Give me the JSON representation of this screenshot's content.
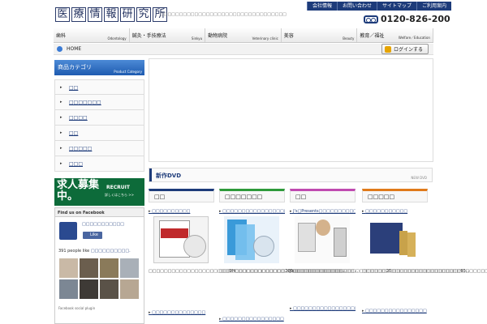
{
  "header": {
    "logo_chars": [
      "医",
      "療",
      "情",
      "報",
      "研",
      "究",
      "所"
    ],
    "tagline": "□□□□□□□□□□□□□□□□□□□□□□□□□□□□□□□□□",
    "util_links": [
      "会社情報",
      "お問い合わせ",
      "サイトマップ",
      "ご利用案内"
    ],
    "phone": "0120-826-200"
  },
  "gnav": [
    {
      "jp": "歯科",
      "en": "Odontology"
    },
    {
      "jp": "鍼灸・手技療法",
      "en": "Sinkyu"
    },
    {
      "jp": "動物病院",
      "en": "Veterinary clinic"
    },
    {
      "jp": "美容",
      "en": "Beauty"
    },
    {
      "jp": "教育／福祉",
      "en": "Welfare／Education"
    }
  ],
  "breadcrumb": "HOME",
  "login_label": "ログインする",
  "sidebar": {
    "title_jp": "商品カテゴリ",
    "title_en": "Product Category",
    "items": [
      "□□",
      "□□□□□□□",
      "□□□□",
      "□□",
      "□□□□□",
      "□□□"
    ]
  },
  "recruit": {
    "big": "求人募集中。",
    "en": "RECRUIT",
    "sub": "詳しくはこちら >>"
  },
  "facebook": {
    "title": "Find us on Facebook",
    "page_name": "□□□□□□□□□□□",
    "like": "Like",
    "count_text": "391 people like",
    "count_page": "□□□□□□□□□□.",
    "footer": "Facebook social plugin"
  },
  "dvd": {
    "title": "新作DVD",
    "en": "NEW DVD"
  },
  "columns": [
    {
      "tab": "□□",
      "link1": "□□□□□□□□□□",
      "desc1": "□□□□□□□□□□□□□□□□□□□□□DH□□□□□□□□□□□□□200□□□□□□□□□□□□□□□□...",
      "link2": "□□□□□□□□□□□□□□"
    },
    {
      "tab": "□□□□□□□",
      "link1": "□□□□□□□□□□□□□□□□□□□□□",
      "desc1": "□□□□□□□□□□□□□□□□□□□□□□□□□□□□□□□□...",
      "link2": "□□□□□□□□□□□□□□□□"
    },
    {
      "tab": "□□",
      "link1": "J's□Presents□□□□□□□□□□□□□□□",
      "desc1": "J's□□□□□□□□□□□□□□□□□□□□□□□□25□□□□□□□□□□□□□□□□□□60...",
      "link2": "□□□□□□□□□□□□□□□□□□□□"
    },
    {
      "tab": "□□□□□",
      "link1": "□□□□□□□□□□□",
      "desc1": "□□□□□□□□□□□□□□□□□□□□□□□□□□□□□□□□□□□□...",
      "link2": "□□□□□□□□□□□□□□□□"
    }
  ],
  "colors": {
    "brand_blue": "#1d3b7a",
    "recruit_green": "#0d6b3a",
    "tab_accents": [
      "#1d3b7a",
      "#2e9a3a",
      "#c04ab0",
      "#e07a1a"
    ]
  }
}
